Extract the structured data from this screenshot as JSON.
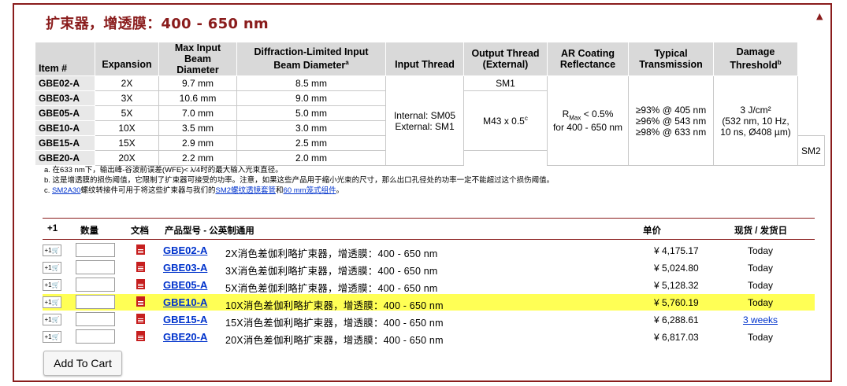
{
  "title": "扩束器，增透膜：400 - 650 nm",
  "collapse_glyph": "▲",
  "spec_table": {
    "headers": {
      "item": "Item #",
      "expansion": "Expansion",
      "max_input": "Max Input Beam Diameter",
      "diffraction": "Diffraction-Limited Input Beam Diameter",
      "diffraction_note": "a",
      "input_thread": "Input Thread",
      "output_thread": "Output Thread (External)",
      "ar_coating": "AR Coating Reflectance",
      "transmission": "Typical Transmission",
      "damage": "Damage Threshold",
      "damage_note": "b"
    },
    "rows": [
      {
        "item": "GBE02-A",
        "expansion": "2X",
        "max_input": "9.7 mm",
        "diffraction": "8.5 mm"
      },
      {
        "item": "GBE03-A",
        "expansion": "3X",
        "max_input": "10.6 mm",
        "diffraction": "9.0 mm"
      },
      {
        "item": "GBE05-A",
        "expansion": "5X",
        "max_input": "7.0 mm",
        "diffraction": "5.0 mm"
      },
      {
        "item": "GBE10-A",
        "expansion": "10X",
        "max_input": "3.5 mm",
        "diffraction": "3.0 mm"
      },
      {
        "item": "GBE15-A",
        "expansion": "15X",
        "max_input": "2.9 mm",
        "diffraction": "2.5 mm"
      },
      {
        "item": "GBE20-A",
        "expansion": "20X",
        "max_input": "2.2 mm",
        "diffraction": "2.0 mm"
      }
    ],
    "input_thread": {
      "line1": "Internal: SM05",
      "line2": "External: SM1"
    },
    "output_thread": {
      "sm1": "SM1",
      "m43": "M43 x 0.5",
      "m43_note": "c",
      "sm2": "SM2"
    },
    "ar": {
      "r": "R",
      "sub": "Max",
      "line1_rest": " < 0.5%",
      "line2": "for 400 - 650 nm"
    },
    "transmission": {
      "line1": "≥93% @ 405 nm",
      "line2": "≥96% @ 543 nm",
      "line3": "≥98% @ 633 nm"
    },
    "damage": {
      "line1": "3 J/cm²",
      "line2": "(532 nm, 10 Hz,",
      "line3": "10 ns, Ø408 µm)"
    }
  },
  "notes": {
    "a": "a. 在633 nm下，输出峰-谷波前误差(WFE)< λ/4时的最大输入光束直径。",
    "b": "b. 这是增透膜的损伤阈值，它限制了扩束器可接受的功率。注意，如果这些产品用于缩小光束的尺寸，那么出口孔径处的功率一定不能超过这个损伤阈值。",
    "c_prefix": "c. ",
    "c_link1": "SM2A30",
    "c_mid1": "螺纹转接件可用于将这些扩束器与我们的",
    "c_link2": "SM2螺纹透镜套管",
    "c_mid2": "和",
    "c_link3": "60 mm笼式组件",
    "c_end": "。"
  },
  "cart": {
    "headers": {
      "add": "+1",
      "qty": "数量",
      "doc": "文档",
      "product": "产品型号 - 公英制通用",
      "price": "单价",
      "avail": "现货 / 发货日"
    },
    "add_glyph": "+1🛒",
    "rows": [
      {
        "pn": "GBE02-A",
        "desc": "2X消色差伽利略扩束器，增透膜：400 - 650 nm",
        "price": "¥ 4,175.17",
        "avail": "Today"
      },
      {
        "pn": "GBE03-A",
        "desc": "3X消色差伽利略扩束器，增透膜：400 - 650 nm",
        "price": "¥ 5,024.80",
        "avail": "Today"
      },
      {
        "pn": "GBE05-A",
        "desc": "5X消色差伽利略扩束器，增透膜：400 - 650 nm",
        "price": "¥ 5,128.32",
        "avail": "Today"
      },
      {
        "pn": "GBE10-A",
        "desc": "10X消色差伽利略扩束器，增透膜：400 - 650 nm",
        "price": "¥ 5,760.19",
        "avail": "Today"
      },
      {
        "pn": "GBE15-A",
        "desc": "15X消色差伽利略扩束器，增透膜：400 - 650 nm",
        "price": "¥ 6,288.61",
        "avail": "3 weeks"
      },
      {
        "pn": "GBE20-A",
        "desc": "20X消色差伽利略扩束器，增透膜：400 - 650 nm",
        "price": "¥ 6,817.03",
        "avail": "Today"
      }
    ],
    "button": "Add To Cart"
  },
  "colors": {
    "accent": "#8a1c1c",
    "link": "#0033cc",
    "highlight": "#ffff55",
    "header_bg": "#d9d9d9"
  }
}
